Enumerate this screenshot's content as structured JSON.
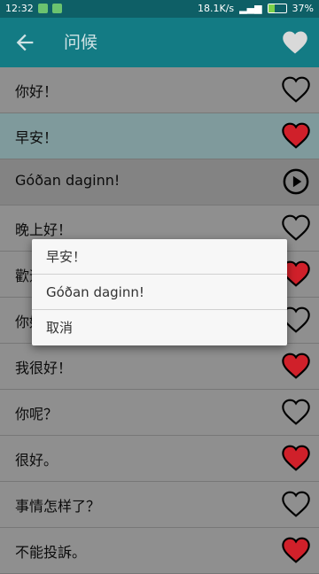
{
  "status": {
    "time": "12:32",
    "speed": "18.1K/s",
    "battery": "37%"
  },
  "appbar": {
    "title": "问候",
    "back_icon": "arrow-left-icon",
    "favorite_icon": "heart-icon"
  },
  "rows": [
    {
      "text": "你好！",
      "icon": "heart-outline",
      "state": "normal"
    },
    {
      "text": "早安！",
      "icon": "heart-filled",
      "state": "selected"
    },
    {
      "text": "Góðan daginn!",
      "icon": "play",
      "state": "translation"
    },
    {
      "text": "晚上好！",
      "icon": "heart-outline",
      "state": "normal"
    },
    {
      "text": "歡迎！",
      "icon": "heart-filled",
      "state": "normal"
    },
    {
      "text": "你好吗？",
      "icon": "heart-outline",
      "state": "normal"
    },
    {
      "text": "我很好！",
      "icon": "heart-filled",
      "state": "normal"
    },
    {
      "text": "你呢？",
      "icon": "heart-outline",
      "state": "normal"
    },
    {
      "text": "很好。",
      "icon": "heart-filled",
      "state": "normal"
    },
    {
      "text": "事情怎样了？",
      "icon": "heart-outline",
      "state": "normal"
    },
    {
      "text": "不能投訴。",
      "icon": "heart-filled",
      "state": "normal"
    }
  ],
  "dialog": {
    "options": [
      "早安！",
      "Góðan daginn!",
      "取消"
    ]
  },
  "colors": {
    "heart_red": "#d0202a",
    "appbar": "#137b84"
  }
}
